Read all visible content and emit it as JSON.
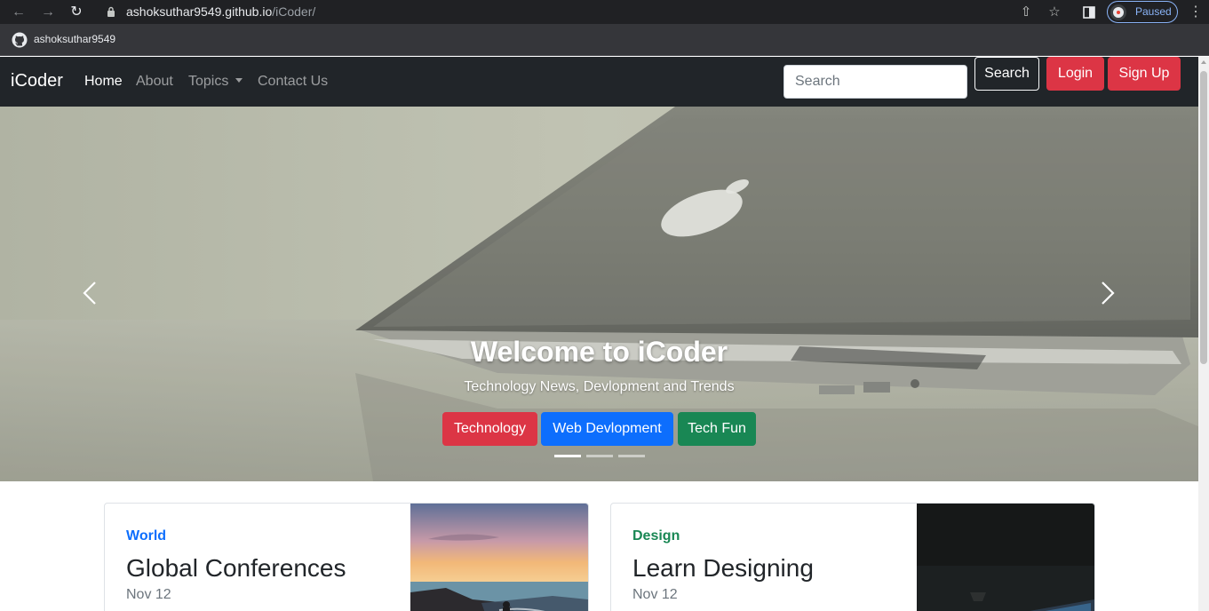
{
  "browser": {
    "url_host": "ashoksuthar9549.github.io",
    "url_path": "/iCoder/",
    "profile_status": "Paused",
    "bookmark_label": "ashoksuthar9549"
  },
  "navbar": {
    "brand": "iCoder",
    "links": [
      "Home",
      "About",
      "Topics",
      "Contact Us"
    ],
    "active_link": "Home",
    "search_placeholder": "Search",
    "search_button": "Search",
    "login_button": "Login",
    "signup_button": "Sign Up"
  },
  "carousel": {
    "title": "Welcome to iCoder",
    "subtitle": "Technology News, Devlopment and Trends",
    "buttons": [
      "Technology",
      "Web Devlopment",
      "Tech Fun"
    ],
    "active_slide": 1,
    "slide_count": 3
  },
  "cards": [
    {
      "category": "World",
      "category_color": "#0d6efd",
      "title": "Global Conferences",
      "date": "Nov 12"
    },
    {
      "category": "Design",
      "category_color": "#198754",
      "title": "Learn Designing",
      "date": "Nov 12"
    }
  ],
  "colors": {
    "navbar_bg": "#212529",
    "danger": "#dc3545",
    "primary": "#0d6efd",
    "success": "#198754"
  }
}
